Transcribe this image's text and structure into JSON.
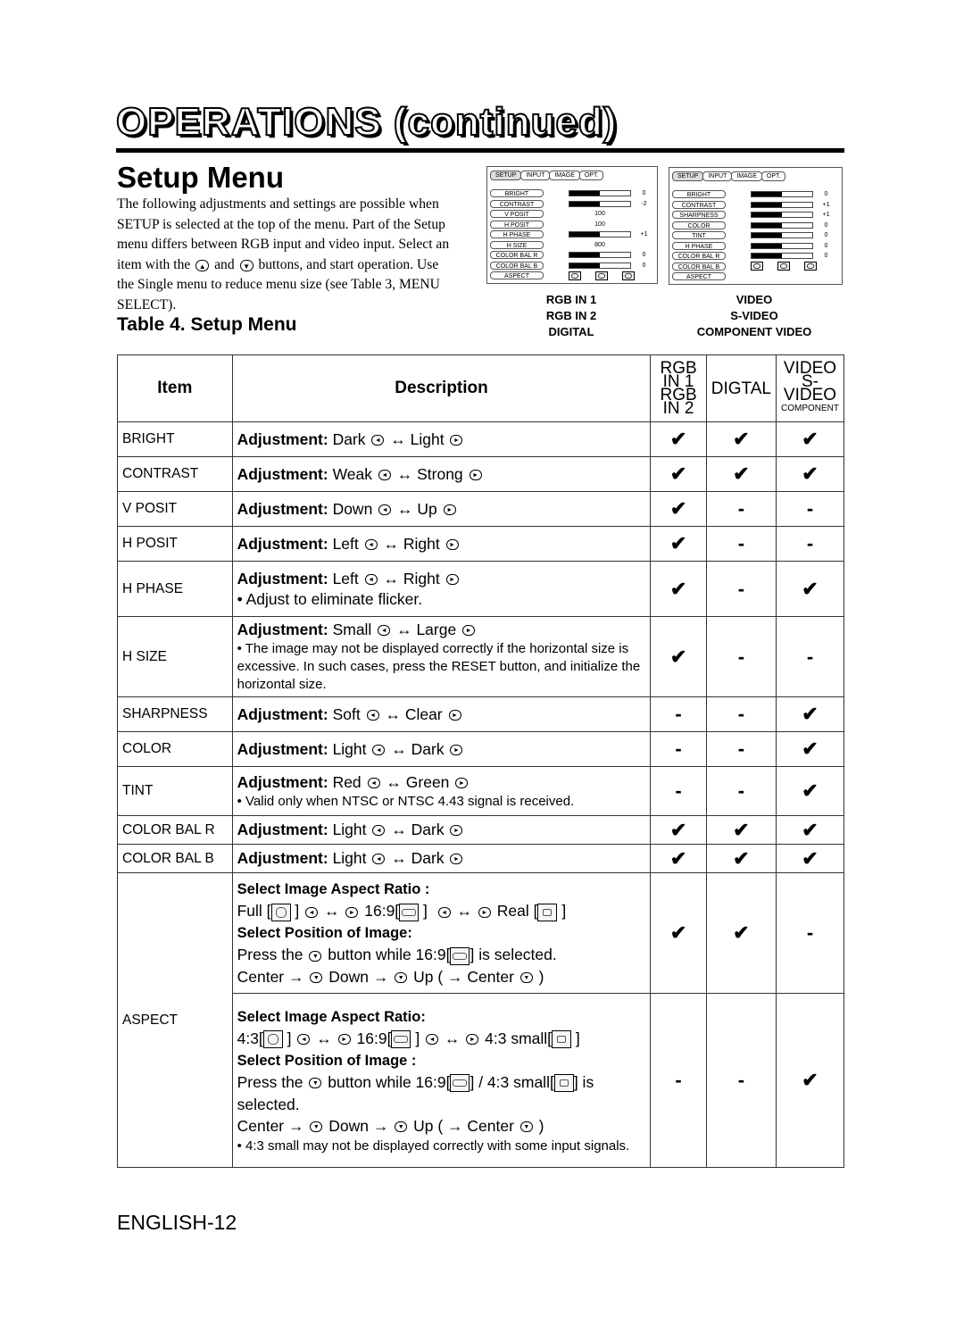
{
  "page": {
    "title": "OPERATIONS (continued)",
    "section_title": "Setup Menu",
    "intro_parts": {
      "a": "The following adjustments and settings are possible when SETUP is selected at the top of the menu. Part of the Setup menu differs between RGB input and video input. Select an item with the",
      "b": "and",
      "c": "buttons, and start operation. Use the Single menu to reduce menu size (see Table 3, MENU SELECT)."
    },
    "table_caption": "Table 4. Setup Menu",
    "footer": "ENGLISH-12"
  },
  "osd_rgb": {
    "tabs": [
      "SETUP",
      "INPUT",
      "IMAGE",
      "OPT."
    ],
    "rows": [
      {
        "label": "BRIGHT",
        "type": "bar",
        "fill": 0.5,
        "value": "0"
      },
      {
        "label": "CONTRAST",
        "type": "bar",
        "fill": 0.5,
        "value": "-2"
      },
      {
        "label": "V POSIT",
        "type": "num",
        "value": "100"
      },
      {
        "label": "H POSIT",
        "type": "num",
        "value": "100"
      },
      {
        "label": "H PHASE",
        "type": "bar",
        "fill": 0.5,
        "value": "+1"
      },
      {
        "label": "H SIZE",
        "type": "num",
        "value": "800"
      },
      {
        "label": "COLOR BAL R",
        "type": "bar",
        "fill": 0.5,
        "value": "0"
      },
      {
        "label": "COLOR BAL B",
        "type": "bar",
        "fill": 0.5,
        "value": "0"
      },
      {
        "label": "ASPECT",
        "type": "aspect"
      }
    ],
    "caption": [
      "RGB IN 1",
      "RGB IN 2",
      "DIGITAL"
    ]
  },
  "osd_video": {
    "tabs": [
      "SETUP",
      "INPUT",
      "IMAGE",
      "OPT."
    ],
    "rows": [
      {
        "label": "BRIGHT",
        "type": "bar",
        "fill": 0.5,
        "value": "0"
      },
      {
        "label": "CONTRAST",
        "type": "bar",
        "fill": 0.5,
        "value": "+1"
      },
      {
        "label": "SHARPNESS",
        "type": "bar",
        "fill": 0.5,
        "value": "+1"
      },
      {
        "label": "COLOR",
        "type": "bar",
        "fill": 0.5,
        "value": "0"
      },
      {
        "label": "TINT",
        "type": "bar",
        "fill": 0.5,
        "value": "0"
      },
      {
        "label": "H PHASE",
        "type": "bar",
        "fill": 0.5,
        "value": "0"
      },
      {
        "label": "COLOR BAL  R",
        "type": "bar",
        "fill": 0.5,
        "value": "0"
      },
      {
        "label": "COLOR BAL  B",
        "type": "aspect"
      },
      {
        "label": "ASPECT",
        "type": "none"
      }
    ],
    "caption": [
      "VIDEO",
      "S-VIDEO",
      "COMPONENT VIDEO"
    ]
  },
  "table": {
    "headers": {
      "item": "Item",
      "description": "Description",
      "rgb": [
        "RGB IN 1",
        "RGB IN 2"
      ],
      "digital": "DIGTAL",
      "video": [
        "VIDEO",
        "S-VIDEO",
        "COMPONENT"
      ]
    },
    "check": "✔",
    "dash": "-",
    "rows": [
      {
        "item": "BRIGHT",
        "adj": "Dark",
        "adj2": "Light",
        "marks": [
          "✔",
          "✔",
          "✔"
        ]
      },
      {
        "item": "CONTRAST",
        "adj": "Weak",
        "adj2": "Strong",
        "marks": [
          "✔",
          "✔",
          "✔"
        ]
      },
      {
        "item": "V POSIT",
        "adj": "Down",
        "adj2": "Up",
        "marks": [
          "✔",
          "-",
          "-"
        ]
      },
      {
        "item": "H POSIT",
        "adj": "Left",
        "adj2": "Right",
        "marks": [
          "✔",
          "-",
          "-"
        ]
      },
      {
        "item": "H PHASE",
        "adj": "Left",
        "adj2": "Right",
        "note": "• Adjust to eliminate flicker.",
        "marks": [
          "✔",
          "-",
          "✔"
        ]
      },
      {
        "item": "H SIZE",
        "adj": "Small",
        "adj2": "Large",
        "note": "• The image may not be displayed correctly if the horizontal size is excessive. In such cases, press the RESET button, and initialize the horizontal size.",
        "marks": [
          "✔",
          "-",
          "-"
        ]
      },
      {
        "item": "SHARPNESS",
        "adj": "Soft",
        "adj2": "Clear",
        "marks": [
          "-",
          "-",
          "✔"
        ]
      },
      {
        "item": "COLOR",
        "adj": "Light",
        "adj2": "Dark",
        "marks": [
          "-",
          "-",
          "✔"
        ]
      },
      {
        "item": "TINT",
        "adj": "Red",
        "adj2": "Green",
        "note": "• Valid only when NTSC or NTSC 4.43 signal is received.",
        "marks": [
          "-",
          "-",
          "✔"
        ]
      },
      {
        "item": "COLOR BAL R",
        "adj": "Light",
        "adj2": "Dark",
        "marks": [
          "✔",
          "✔",
          "✔"
        ]
      },
      {
        "item": "COLOR BAL B",
        "adj": "Light",
        "adj2": "Dark",
        "marks": [
          "✔",
          "✔",
          "✔"
        ]
      }
    ],
    "adjustment_label": "Adjustment:",
    "aspect": {
      "item": "ASPECT",
      "rgb": {
        "ratio_heading": "Select Image Aspect Ratio :",
        "opt1": "Full [",
        "opt2": "16:9[",
        "opt3": "Real [",
        "position_heading": "Select Position of Image:",
        "press_a": "Press the",
        "press_b": "button while 16:9[",
        "press_c": "] is selected.",
        "seq": {
          "center": "Center →",
          "down": "Down →",
          "up": "Up ( → Center",
          "close": ")"
        },
        "marks": [
          "✔",
          "✔",
          "-"
        ]
      },
      "video": {
        "ratio_heading": "Select Image Aspect Ratio:",
        "opt1": "4:3[",
        "opt2": "16:9[",
        "opt3": "4:3 small[",
        "position_heading": "Select Position of Image :",
        "press_a": "Press the",
        "press_b": "button while 16:9[",
        "press_mid": "] / 4:3 small[",
        "press_c": "] is selected.",
        "seq": {
          "center": "Center →",
          "down": "Down →",
          "up": "Up ( → Center",
          "close": ")"
        },
        "note": "• 4:3 small may not be displayed correctly with some input signals.",
        "marks": [
          "-",
          "-",
          "✔"
        ]
      }
    }
  }
}
